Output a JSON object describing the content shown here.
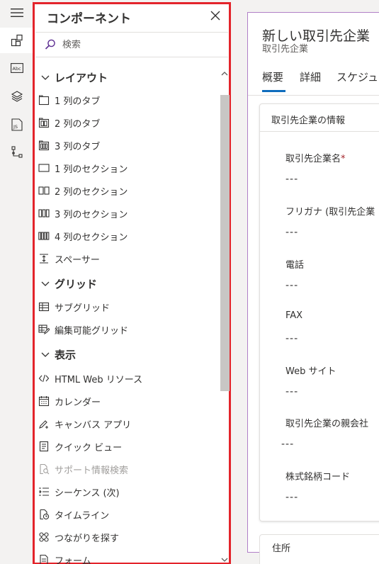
{
  "rail": {
    "items": [
      {
        "icon": "hamburger-menu-icon",
        "active": false
      },
      {
        "icon": "components-icon",
        "active": true
      },
      {
        "icon": "text-field-icon",
        "active": false
      },
      {
        "icon": "layers-icon",
        "active": false
      },
      {
        "icon": "javascript-icon",
        "active": false
      },
      {
        "icon": "tree-view-icon",
        "active": false
      }
    ]
  },
  "panel": {
    "title": "コンポーネント",
    "close_icon": "close-icon",
    "search": {
      "placeholder": "検索",
      "value": ""
    },
    "sections": [
      {
        "label": "レイアウト",
        "items": [
          "1 列のタブ",
          "2 列のタブ",
          "3 列のタブ",
          "1 列のセクション",
          "2 列のセクション",
          "3 列のセクション",
          "4 列のセクション",
          "スペーサー"
        ]
      },
      {
        "label": "グリッド",
        "items": [
          "サブグリッド",
          "編集可能グリッド"
        ]
      },
      {
        "label": "表示",
        "items": [
          "HTML Web リソース",
          "カレンダー",
          "キャンバス アプリ",
          "クイック ビュー",
          "サポート情報検索",
          "シーケンス (次)",
          "タイムライン",
          "つながりを探す",
          "フォーム"
        ]
      }
    ],
    "disabled_item": "サポート情報検索"
  },
  "form": {
    "title": "新しい取引先企業",
    "subtitle": "取引先企業",
    "tabs": [
      "概要",
      "詳細",
      "スケジュ"
    ],
    "active_tab": "概要",
    "info_section": {
      "heading": "取引先企業の情報",
      "fields": [
        {
          "label": "取引先企業名",
          "required": "*",
          "value": "---"
        },
        {
          "label": "フリガナ (取引先企業",
          "value": "---"
        },
        {
          "label": "電話",
          "value": "---"
        },
        {
          "label": "FAX",
          "value": "---"
        },
        {
          "label": "Web サイト",
          "value": "---"
        },
        {
          "label": "取引先企業の親会社",
          "value": "---"
        },
        {
          "label": "株式銘柄コード",
          "value": "---"
        }
      ]
    },
    "address_section": {
      "heading": "住所"
    }
  },
  "colors": {
    "accent": "#0f6cbd",
    "highlight_border": "#e3242b",
    "form_border": "#b07fc7",
    "required": "#a4262c"
  }
}
